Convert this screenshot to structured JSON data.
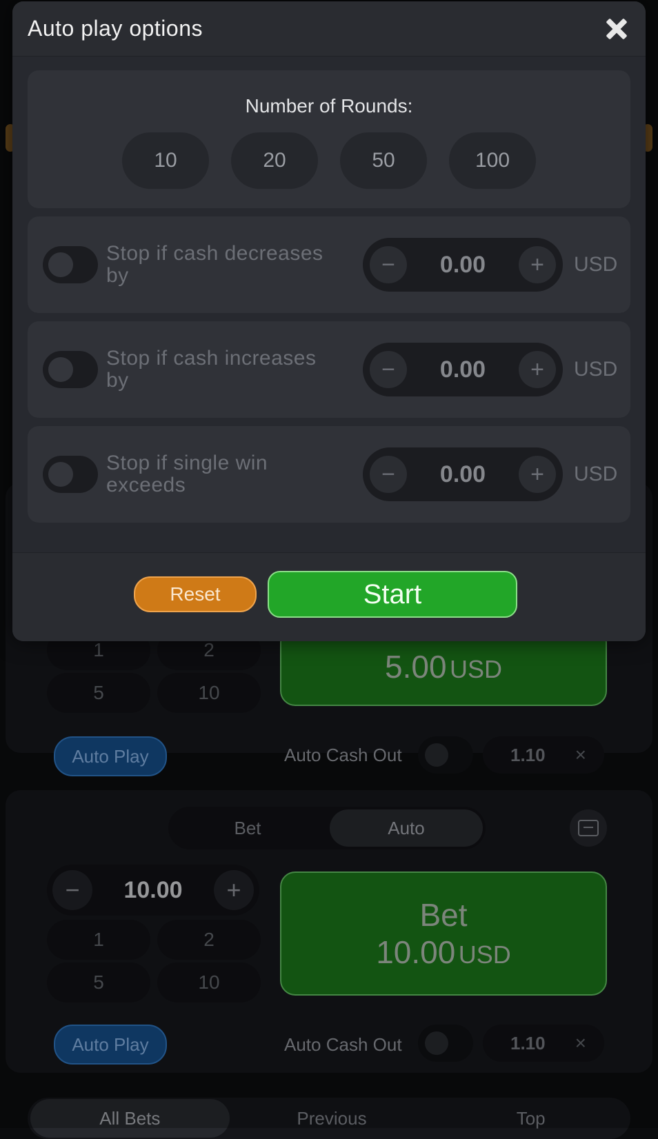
{
  "modal": {
    "title": "Auto play options",
    "rounds_label": "Number of Rounds:",
    "round_options": [
      "10",
      "20",
      "50",
      "100"
    ],
    "stop_conditions": [
      {
        "label": "Stop if cash decreases by",
        "value": "0.00",
        "currency": "USD"
      },
      {
        "label": "Stop if cash increases by",
        "value": "0.00",
        "currency": "USD"
      },
      {
        "label": "Stop if single win exceeds",
        "value": "0.00",
        "currency": "USD"
      }
    ],
    "reset_label": "Reset",
    "start_label": "Start"
  },
  "background": {
    "panel1": {
      "chips": [
        "1",
        "2",
        "5",
        "10"
      ],
      "bet_amount": "5.00",
      "bet_unit": "USD",
      "auto_play_label": "Auto Play",
      "auto_cash_out_label": "Auto Cash Out",
      "auto_cash_out_value": "1.10",
      "clear_glyph": "×"
    },
    "panel2": {
      "tabs": [
        "Bet",
        "Auto"
      ],
      "stepper_value": "10.00",
      "chips": [
        "1",
        "2",
        "5",
        "10"
      ],
      "bet_label": "Bet",
      "bet_amount": "10.00",
      "bet_unit": "USD",
      "auto_play_label": "Auto Play",
      "auto_cash_out_label": "Auto Cash Out",
      "auto_cash_out_value": "1.10",
      "clear_glyph": "×"
    },
    "bottom_tabs": [
      "All Bets",
      "Previous",
      "Top"
    ]
  },
  "colors": {
    "start_green": "#22a628",
    "reset_orange": "#cf7a17",
    "auto_play_blue": "#154a82",
    "bet_green": "#1a7019"
  }
}
